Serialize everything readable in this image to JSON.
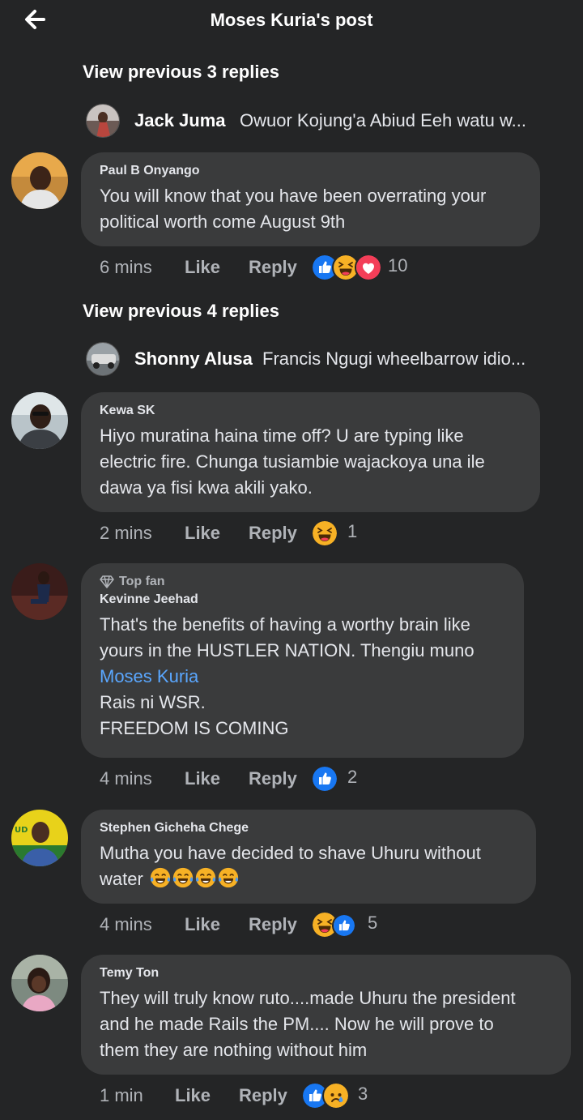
{
  "header": {
    "title": "Moses Kuria's post"
  },
  "view_previous_1": "View previous 3 replies",
  "collapsed_1": {
    "name": "Jack Juma",
    "text": "Owuor Kojung'a Abiud Eeh watu w..."
  },
  "comment_1": {
    "author": "Paul B Onyango",
    "lines": [
      "You will know that you have been overrating your",
      "political worth come August 9th"
    ],
    "time": "6 mins",
    "like": "Like",
    "reply": "Reply",
    "reaction_count": "10"
  },
  "view_previous_2": "View previous 4 replies",
  "collapsed_2": {
    "name": "Shonny Alusa",
    "text": "Francis Ngugi wheelbarrow idio..."
  },
  "comment_2": {
    "author": "Kewa SK",
    "lines": [
      "Hiyo muratina haina time off? U are typing like",
      "electric fire. Chunga tusiambie wajackoya una ile",
      "dawa  ya fisi kwa akili yako."
    ],
    "time": "2 mins",
    "like": "Like",
    "reply": "Reply",
    "reaction_count": "1"
  },
  "comment_3": {
    "badge": "Top fan",
    "author": "Kevinne Jeehad",
    "line1": "That's the benefits of having a worthy brain like",
    "line2": "yours in the HUSTLER NATION. Thengiu muno",
    "mention": "Moses Kuria",
    "line4": "Rais ni WSR.",
    "line5": "FREEDOM IS COMING",
    "time": "4 mins",
    "like": "Like",
    "reply": "Reply",
    "reaction_count": "2"
  },
  "comment_4": {
    "author": "Stephen Gicheha Chege",
    "line1": "Mutha you have decided to shave Uhuru without",
    "line2": "water",
    "time": "4 mins",
    "like": "Like",
    "reply": "Reply",
    "reaction_count": "5"
  },
  "comment_5": {
    "author": "Temy Ton",
    "lines": [
      "They will truly know ruto....made Uhuru the president",
      "and he made Rails the PM.... Now he will prove to",
      "them they are nothing without him"
    ],
    "time": "1 min",
    "like": "Like",
    "reply": "Reply",
    "reaction_count": "3"
  },
  "colors": {
    "background": "#242526",
    "bubble": "#3a3b3c",
    "mention": "#5aa7ff",
    "like": "#1877f2",
    "love": "#f33e58",
    "haha": "#f7b125"
  }
}
